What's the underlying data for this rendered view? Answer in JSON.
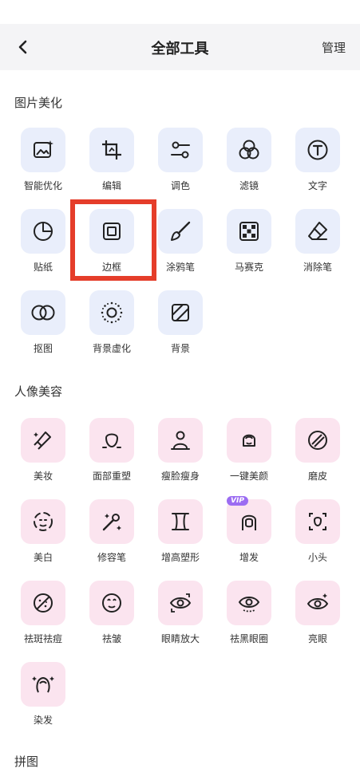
{
  "header": {
    "title": "全部工具",
    "manage_label": "管理"
  },
  "sections": [
    {
      "title": "图片美化"
    },
    {
      "title": "人像美容"
    },
    {
      "title": "拼图"
    }
  ],
  "photo_tools": [
    {
      "label": "智能优化",
      "icon": "image-spark-icon"
    },
    {
      "label": "编辑",
      "icon": "crop-icon"
    },
    {
      "label": "调色",
      "icon": "sliders-icon"
    },
    {
      "label": "滤镜",
      "icon": "filter-circles-icon"
    },
    {
      "label": "文字",
      "icon": "text-t-icon"
    },
    {
      "label": "贴纸",
      "icon": "sticker-icon"
    },
    {
      "label": "边框",
      "icon": "frame-icon"
    },
    {
      "label": "涂鸦笔",
      "icon": "brush-icon"
    },
    {
      "label": "马赛克",
      "icon": "mosaic-icon"
    },
    {
      "label": "消除笔",
      "icon": "eraser-icon"
    },
    {
      "label": "抠图",
      "icon": "cutout-icon"
    },
    {
      "label": "背景虚化",
      "icon": "blur-dots-icon"
    },
    {
      "label": "背景",
      "icon": "background-hatch-icon"
    }
  ],
  "portrait_tools": [
    {
      "label": "美妆",
      "icon": "lipstick-icon"
    },
    {
      "label": "面部重塑",
      "icon": "face-reshape-icon"
    },
    {
      "label": "瘦脸瘦身",
      "icon": "slim-body-icon"
    },
    {
      "label": "一键美颜",
      "icon": "beauty-face-icon"
    },
    {
      "label": "磨皮",
      "icon": "smooth-skin-icon"
    },
    {
      "label": "美白",
      "icon": "whiten-face-icon"
    },
    {
      "label": "修容笔",
      "icon": "contour-wand-icon"
    },
    {
      "label": "增高塑形",
      "icon": "height-shape-icon"
    },
    {
      "label": "增发",
      "icon": "hair-icon",
      "badge": "VIP"
    },
    {
      "label": "小头",
      "icon": "small-head-icon"
    },
    {
      "label": "祛斑祛痘",
      "icon": "blemish-icon"
    },
    {
      "label": "祛皱",
      "icon": "wrinkle-icon"
    },
    {
      "label": "眼睛放大",
      "icon": "eye-enlarge-icon"
    },
    {
      "label": "祛黑眼圈",
      "icon": "dark-circle-icon"
    },
    {
      "label": "亮眼",
      "icon": "bright-eye-icon"
    },
    {
      "label": "染发",
      "icon": "hair-dye-icon"
    }
  ],
  "colors": {
    "blue_tile": "#e9eefb",
    "pink_tile": "#fbe4ef",
    "highlight": "#e53d2a",
    "vip": "#9b6cf2"
  }
}
